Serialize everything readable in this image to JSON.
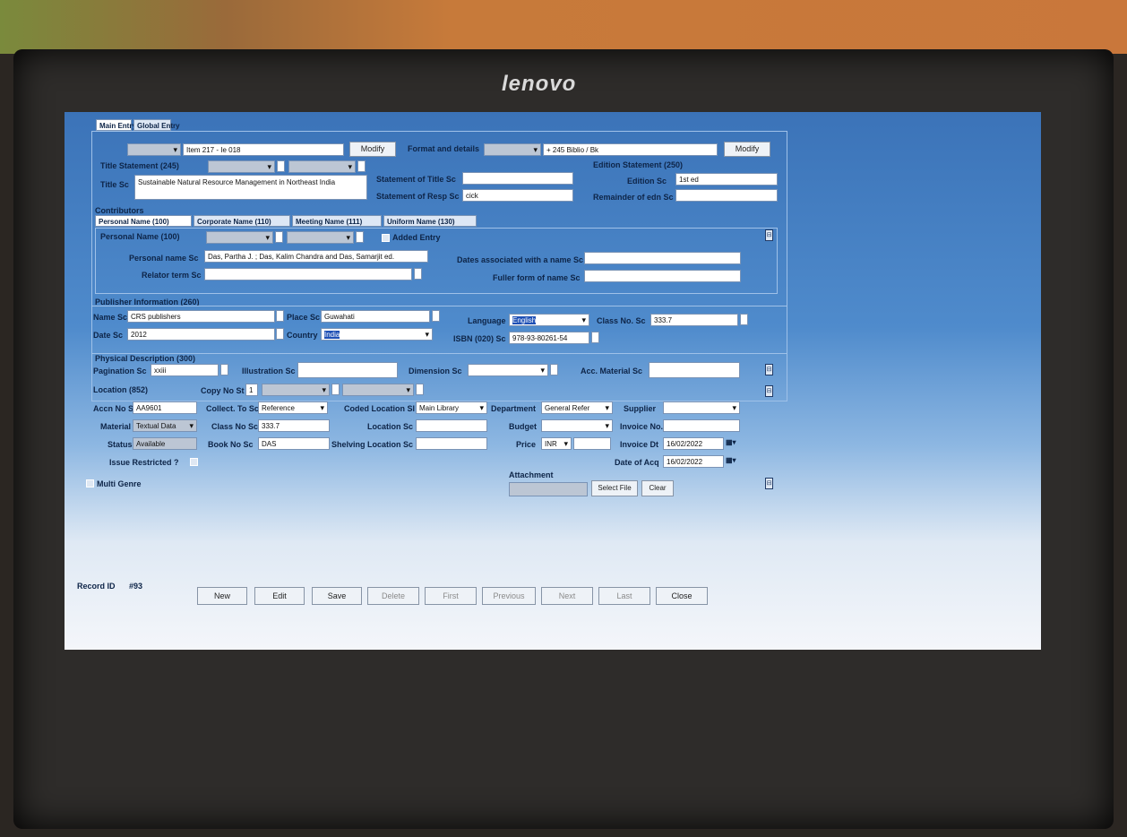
{
  "device": {
    "brand": "lenovo"
  },
  "window": {
    "tabs": [
      "Main Entry",
      "Global Entry"
    ],
    "top": {
      "search_type": "",
      "search_value": "Item 217 - Ie 018",
      "modify_label": "Modify",
      "format_label": "Format and details",
      "format_type": "",
      "record_value": "+ 245 Biblio / Bk",
      "modify2_label": "Modify"
    },
    "title_row": {
      "entry_label": "Title Statement (245)",
      "title_label": "Title Sc",
      "title_value": "Sustainable Natural Resource Management in Northeast India",
      "responsibility_label": "Statement of Title Sc",
      "responsibility_value": "",
      "remainder_label": "Statement of Resp Sc",
      "remainder_value": "cick",
      "edition_group_label": "Edition Statement (250)",
      "edition_label": "Edition Sc",
      "edition_value": "1st ed",
      "remainder_edition_label": "Remainder of edn Sc",
      "remainder_edition_value": ""
    },
    "contrib": {
      "section_label": "Contributors",
      "tabs": [
        "Personal Name (100)",
        "Corporate Name (110)",
        "Meeting Name (111)",
        "Uniform Name (130)"
      ],
      "personal_title_label": "Personal Name (100)",
      "added_entry_label": "Added Entry",
      "personal_name_label": "Personal name Sc",
      "personal_name_value": "Das, Partha J. ; Das, Kalim Chandra and Das, Samarjit ed.",
      "relator_label": "Relator term Sc",
      "relator_value": "",
      "dates_label": "Dates associated with a name Sc",
      "dates_value": "",
      "fuller_label": "Fuller form of name Sc",
      "fuller_value": ""
    },
    "publisher": {
      "section_label": "Publisher Information (260)",
      "name_label": "Name Sc",
      "name_value": "CRS publishers",
      "place_label": "Place Sc",
      "place_value": "Guwahati",
      "date_label": "Date Sc",
      "date_value": "2012",
      "country_label": "Country",
      "country_value": "India",
      "language_label": "Language",
      "language_value": "English",
      "class_label": "Class No. Sc",
      "class_value": "333.7",
      "isbn_label": "ISBN (020) Sc",
      "isbn_value": "978-93-80261-54"
    },
    "physical": {
      "section_label": "Physical Description (300)",
      "pagination_label": "Pagination Sc",
      "pagination_value": "xxiii",
      "illustration_label": "Illustration Sc",
      "illustration_value": "",
      "dimension_label": "Dimension Sc",
      "dimension_value": "",
      "accmaterial_label": "Acc. Material Sc",
      "accmaterial_value": ""
    },
    "location": {
      "section_label": "Location (852)",
      "copy_label": "Copy No St",
      "copy_value": "1",
      "accn_label": "Accn No Sc",
      "accn_value": "AA9601",
      "material_label": "Material",
      "material_value": "Textual Data",
      "status_label": "Status",
      "status_value": "Available",
      "issue_label": "Issue Restricted ?",
      "collect_label": "Collect. To Sc",
      "collect_value": "Reference",
      "classno_label": "Class No Sc",
      "classno_value": "333.7",
      "bookno_label": "Book No Sc",
      "bookno_value": "DAS",
      "coded_label": "Coded Location Sl",
      "coded_value": "Main Library",
      "loc_label": "Location Sc",
      "loc_value": "",
      "shelving_label": "Shelving Location Sc",
      "shelving_value": "",
      "dept_label": "Department",
      "dept_value": "General Refer",
      "budget_label": "Budget",
      "budget_value": "",
      "price_label": "Price",
      "currency_value": "INR",
      "price_value": "",
      "supplier_label": "Supplier",
      "supplier_value": "",
      "invoice_label": "Invoice No.",
      "invoice_value": "",
      "invoice_date_label": "Invoice Dt",
      "invoice_date_value": "16/02/2022",
      "acq_date_label": "Date of Acq",
      "acq_date_value": "16/02/2022"
    },
    "multi_genre_label": "Multi Genre",
    "attachment": {
      "label": "Attachment",
      "value": "",
      "select_label": "Select File",
      "clear_label": "Clear"
    },
    "record": {
      "label": "Record ID",
      "value": "#93"
    },
    "buttons": {
      "new": "New",
      "edit": "Edit",
      "save": "Save",
      "delete": "Delete",
      "first": "First",
      "previous": "Previous",
      "next": "Next",
      "last": "Last",
      "close": "Close"
    }
  }
}
